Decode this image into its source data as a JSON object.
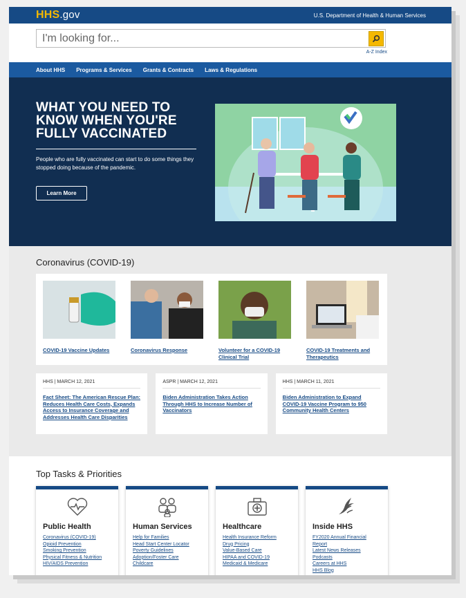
{
  "header": {
    "logo_hhs": "HHS",
    "logo_gov": ".gov",
    "department": "U.S. Department of Health & Human Services"
  },
  "search": {
    "placeholder": "I'm looking for...",
    "az_index": "A-Z Index"
  },
  "nav": {
    "items": [
      "About HHS",
      "Programs & Services",
      "Grants & Contracts",
      "Laws & Regulations"
    ]
  },
  "hero": {
    "title": "WHAT YOU NEED TO KNOW WHEN YOU'RE FULLY VACCINATED",
    "text": "People who are fully vaccinated can start to do some things they stopped doing because of the pandemic.",
    "button": "Learn More"
  },
  "covid": {
    "heading": "Coronavirus (COVID-19)",
    "cards": [
      {
        "label": "COVID-19 Vaccine Updates"
      },
      {
        "label": "Coronavirus Response"
      },
      {
        "label": "Volunteer for a COVID-19 Clinical Trial"
      },
      {
        "label": "COVID-19 Treatments and Therapeutics"
      }
    ],
    "news": [
      {
        "meta": "HHS | MARCH 12, 2021",
        "title": "Fact Sheet: The American Rescue Plan: Reduces Health Care Costs, Expands Access to Insurance Coverage and Addresses Health Care Disparities"
      },
      {
        "meta": "ASPR | MARCH 12, 2021",
        "title": "Biden Administration Takes Action Through HHS to Increase Number of Vaccinators"
      },
      {
        "meta": "HHS | MARCH 11, 2021",
        "title": "Biden Administration to Expand COVID-19 Vaccine Program to 950 Community Health Centers"
      }
    ]
  },
  "tasks": {
    "heading": "Top Tasks & Priorities",
    "cards": [
      {
        "title": "Public Health",
        "links": [
          "Coronavirus (COVID-19)",
          "Opioid Prevention",
          "Smoking Prevention",
          "Physical Fitness & Nutrition",
          "HIV/AIDS Prevention"
        ]
      },
      {
        "title": "Human Services",
        "links": [
          "Help for Families",
          "Head Start Center Locator",
          "Poverty Guidelines",
          "Adoption/Foster Care",
          "Childcare"
        ]
      },
      {
        "title": "Healthcare",
        "links": [
          "Health Insurance Reform",
          "Drug Pricing",
          "Value-Based Care",
          "HIPAA and COVID-19",
          "Medicaid & Medicare"
        ]
      },
      {
        "title": "Inside HHS",
        "links": [
          "FY2020 Annual Financial Report",
          "Latest News Releases",
          "Podcasts",
          "Careers at HHS",
          "HHS Blog"
        ]
      }
    ]
  }
}
